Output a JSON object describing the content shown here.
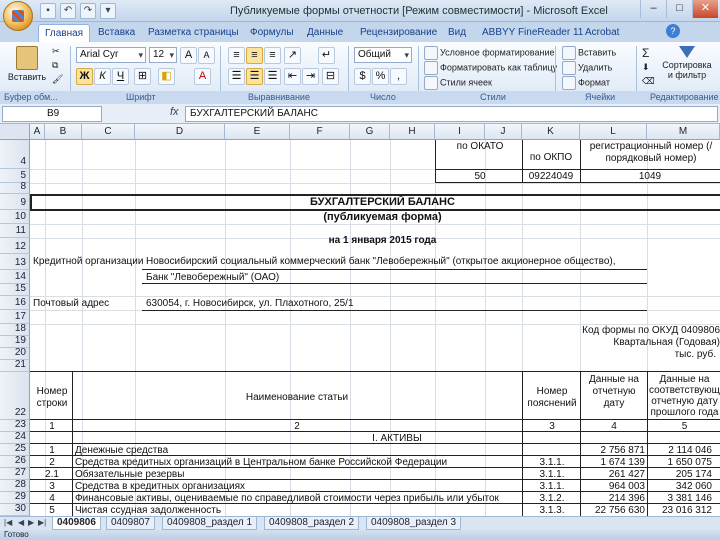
{
  "window": {
    "title": "Публикуемые формы отчетности [Режим совместимости] - Microsoft Excel"
  },
  "ribbon": {
    "tabs": [
      "Главная",
      "Вставка",
      "Разметка страницы",
      "Формулы",
      "Данные",
      "Рецензирование",
      "Вид",
      "ABBYY FineReader 11",
      "Acrobat"
    ],
    "paste_label": "Вставить",
    "font_name": "Arial Cyr",
    "font_size": "12",
    "number_format": "Общий",
    "cond_format": "Условное форматирование",
    "format_table": "Форматировать как таблицу",
    "cell_styles": "Стили ячеек",
    "insert_label": "Вставить",
    "delete_label": "Удалить",
    "format_label": "Формат",
    "sort_label": "Сортировка и фильтр",
    "groups": [
      "Буфер обм...",
      "Шрифт",
      "Выравнивание",
      "Число",
      "Стили",
      "Ячейки",
      "Редактирование"
    ]
  },
  "formula": {
    "namebox": "B9",
    "fx": "fx",
    "content": "БУХГАЛТЕРСКИЙ БАЛАНС"
  },
  "columns": [
    "A",
    "B",
    "C",
    "D",
    "E",
    "F",
    "G",
    "H",
    "I",
    "J",
    "K",
    "L",
    "M"
  ],
  "rows": [
    "4",
    "5",
    "8",
    "9",
    "10",
    "11",
    "12",
    "13",
    "14",
    "15",
    "16",
    "17",
    "18",
    "19",
    "20",
    "21",
    "22",
    "23",
    "24",
    "25",
    "26",
    "27",
    "28",
    "29",
    "30"
  ],
  "sheet": {
    "okato_label": "по ОКАТО",
    "okpo_label": "по ОКПО",
    "regnum_label": "регистрационный номер (/порядковый номер)",
    "okato_value": "50",
    "okpo_value": "09224049",
    "regnum_value": "1049",
    "heading": "БУХГАЛТЕРСКИЙ БАЛАНС",
    "subheading": "(публикуемая форма)",
    "date_line": "на 1 января 2015 года",
    "org_label": "Кредитной организации",
    "org_value": "Новосибирский социальный коммерческий банк \"Левобережный\" (открытое акционерное общество),",
    "org_short": "Банк \"Левобережный\" (ОАО)",
    "addr_label": "Почтовый адрес",
    "addr_value": "630054, г. Новосибирск, ул. Плахотного, 25/1",
    "okud_line": "Код формы по ОКУД 0409806",
    "period_line": "Квартальная (Годовая)",
    "units_line": "тыс. руб.",
    "col_num_header": "Номер строки",
    "col_name_header": "Наименование статьи",
    "col_note_header": "Номер пояснений",
    "col_current_header": "Данные на отчетную дату",
    "col_prev_header": "Данные на соответствующую отчетную дату прошлого года",
    "col_idx": [
      "1",
      "2",
      "3",
      "4",
      "5"
    ],
    "section": "I. АКТИВЫ",
    "items": [
      {
        "num": "1",
        "name": "Денежные средства",
        "note": "",
        "cur": "2 756 871",
        "prev": "2 114 046"
      },
      {
        "num": "2",
        "name": "Средства кредитных организаций в Центральном банке Российской Федерации",
        "note": "3.1.1.",
        "cur": "1 674 139",
        "prev": "1 650 075"
      },
      {
        "num": "2.1",
        "name": "Обязательные резервы",
        "note": "3.1.1.",
        "cur": "261 427",
        "prev": "205 174"
      },
      {
        "num": "3",
        "name": "Средства в кредитных организациях",
        "note": "3.1.1.",
        "cur": "964 003",
        "prev": "342 060"
      },
      {
        "num": "4",
        "name": "Финансовые активы, оцениваемые по справедливой стоимости через прибыль или убыток",
        "note": "3.1.2.",
        "cur": "214 396",
        "prev": "3 381 146"
      },
      {
        "num": "5",
        "name": "Чистая ссудная задолженность",
        "note": "3.1.3.",
        "cur": "22 756 630",
        "prev": "23 016 312"
      }
    ]
  },
  "sheet_tabs": [
    "0409806",
    "0409807",
    "0409808_раздел 1",
    "0409808_раздел 2",
    "0409808_раздел 3"
  ],
  "status": "Готово"
}
